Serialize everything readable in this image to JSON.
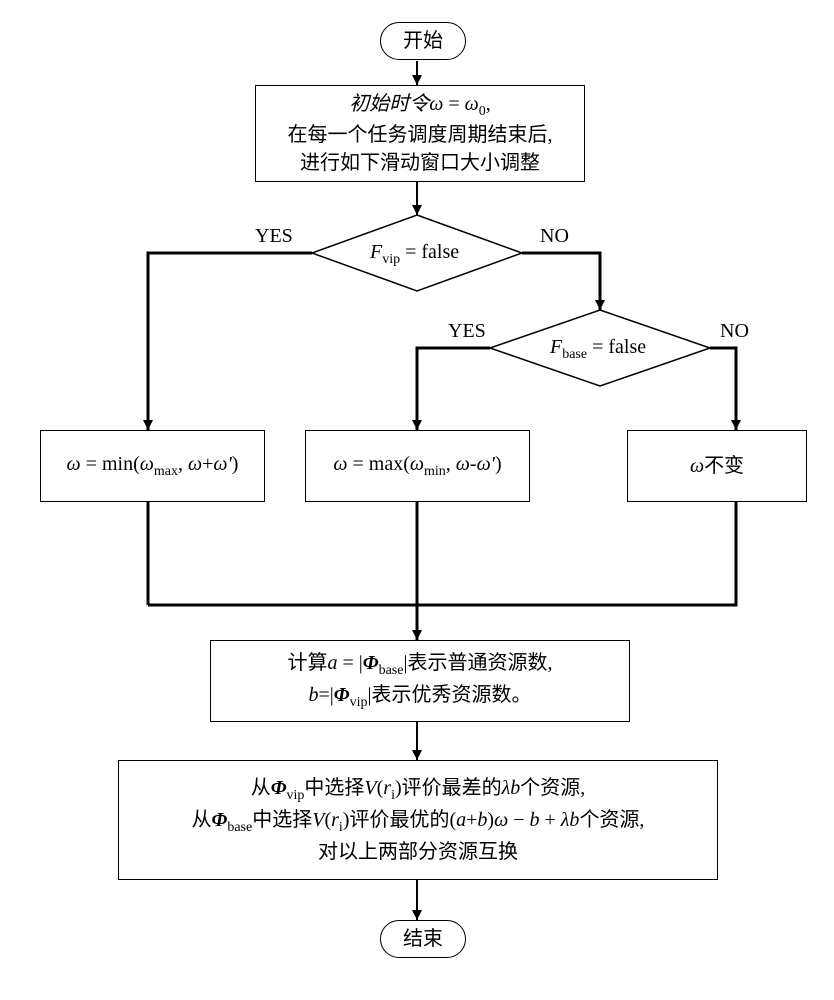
{
  "terminator": {
    "start": "开始",
    "end": "结束"
  },
  "init": {
    "l1": "初始时令ω = ω₀,",
    "l2": "在每一个任务调度周期结束后,",
    "l3": "进行如下滑动窗口大小调整"
  },
  "decision": {
    "fvip": "Fvip = false",
    "fbase": "Fbase = false"
  },
  "labels": {
    "yes": "YES",
    "no": "NO"
  },
  "actions": {
    "inc": "ω = min(ωmax, ω+ω')",
    "dec": "ω = max(ωmin, ω-ω')",
    "same": "ω不变"
  },
  "calc": {
    "l1": "计算a = |Φbase|表示普通资源数,",
    "l2": "b=|Φvip|表示优秀资源数。"
  },
  "swap": {
    "l1": "从Φvip中选择V(ri)评价最差的λb个资源,",
    "l2": "从Φbase中选择V(ri)评价最优的(a+b)ω − b + λb个资源,",
    "l3": "对以上两部分资源互换"
  },
  "chart_data": {
    "type": "flowchart",
    "nodes": [
      {
        "id": "start",
        "type": "terminator",
        "label": "开始"
      },
      {
        "id": "init",
        "type": "process",
        "label": "初始时令ω=ω₀, 在每一个任务调度周期结束后, 进行如下滑动窗口大小调整"
      },
      {
        "id": "d1",
        "type": "decision",
        "label": "F_vip = false"
      },
      {
        "id": "d2",
        "type": "decision",
        "label": "F_base = false"
      },
      {
        "id": "a1",
        "type": "process",
        "label": "ω = min(ω_max, ω+ω')"
      },
      {
        "id": "a2",
        "type": "process",
        "label": "ω = max(ω_min, ω-ω')"
      },
      {
        "id": "a3",
        "type": "process",
        "label": "ω不变"
      },
      {
        "id": "calc",
        "type": "process",
        "label": "计算a=|Φ_base|表示普通资源数, b=|Φ_vip|表示优秀资源数。"
      },
      {
        "id": "swap",
        "type": "process",
        "label": "从Φ_vip中选择V(r_i)评价最差的λb个资源, 从Φ_base中选择V(r_i)评价最优的(a+b)ω−b+λb个资源, 对以上两部分资源互换"
      },
      {
        "id": "end",
        "type": "terminator",
        "label": "结束"
      }
    ],
    "edges": [
      {
        "from": "start",
        "to": "init"
      },
      {
        "from": "init",
        "to": "d1"
      },
      {
        "from": "d1",
        "to": "a1",
        "label": "YES"
      },
      {
        "from": "d1",
        "to": "d2",
        "label": "NO"
      },
      {
        "from": "d2",
        "to": "a2",
        "label": "YES"
      },
      {
        "from": "d2",
        "to": "a3",
        "label": "NO"
      },
      {
        "from": "a1",
        "to": "calc"
      },
      {
        "from": "a2",
        "to": "calc"
      },
      {
        "from": "a3",
        "to": "calc"
      },
      {
        "from": "calc",
        "to": "swap"
      },
      {
        "from": "swap",
        "to": "end"
      }
    ]
  }
}
